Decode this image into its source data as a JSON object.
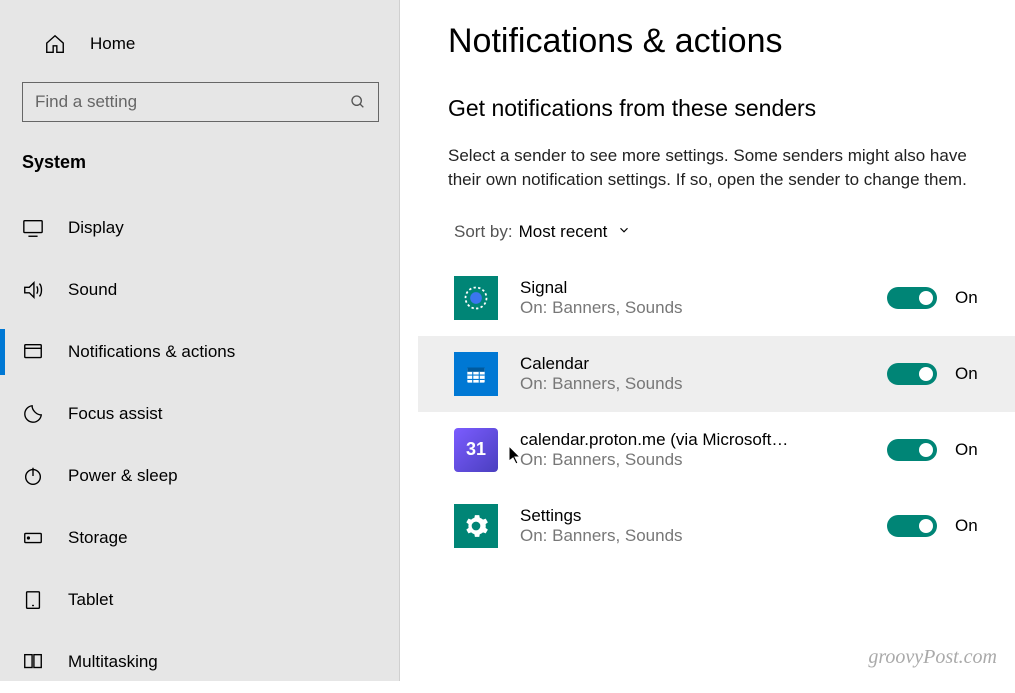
{
  "sidebar": {
    "home_label": "Home",
    "search_placeholder": "Find a setting",
    "category_label": "System",
    "items": [
      {
        "label": "Display"
      },
      {
        "label": "Sound"
      },
      {
        "label": "Notifications & actions"
      },
      {
        "label": "Focus assist"
      },
      {
        "label": "Power & sleep"
      },
      {
        "label": "Storage"
      },
      {
        "label": "Tablet"
      },
      {
        "label": "Multitasking"
      }
    ]
  },
  "main": {
    "title": "Notifications & actions",
    "section_title": "Get notifications from these senders",
    "section_desc": "Select a sender to see more settings. Some senders might also have their own notification settings. If so, open the sender to change them.",
    "sort_label": "Sort by:",
    "sort_value": "Most recent",
    "senders": {
      "0": {
        "name": "Signal",
        "sub": "On: Banners, Sounds",
        "toggle": "On"
      },
      "1": {
        "name": "Calendar",
        "sub": "On: Banners, Sounds",
        "toggle": "On"
      },
      "2": {
        "name": "calendar.proton.me (via Microsoft…",
        "sub": "On: Banners, Sounds",
        "toggle": "On",
        "icon_text": "31"
      },
      "3": {
        "name": "Settings",
        "sub": "On: Banners, Sounds",
        "toggle": "On"
      }
    }
  },
  "watermark": "groovyPost.com"
}
